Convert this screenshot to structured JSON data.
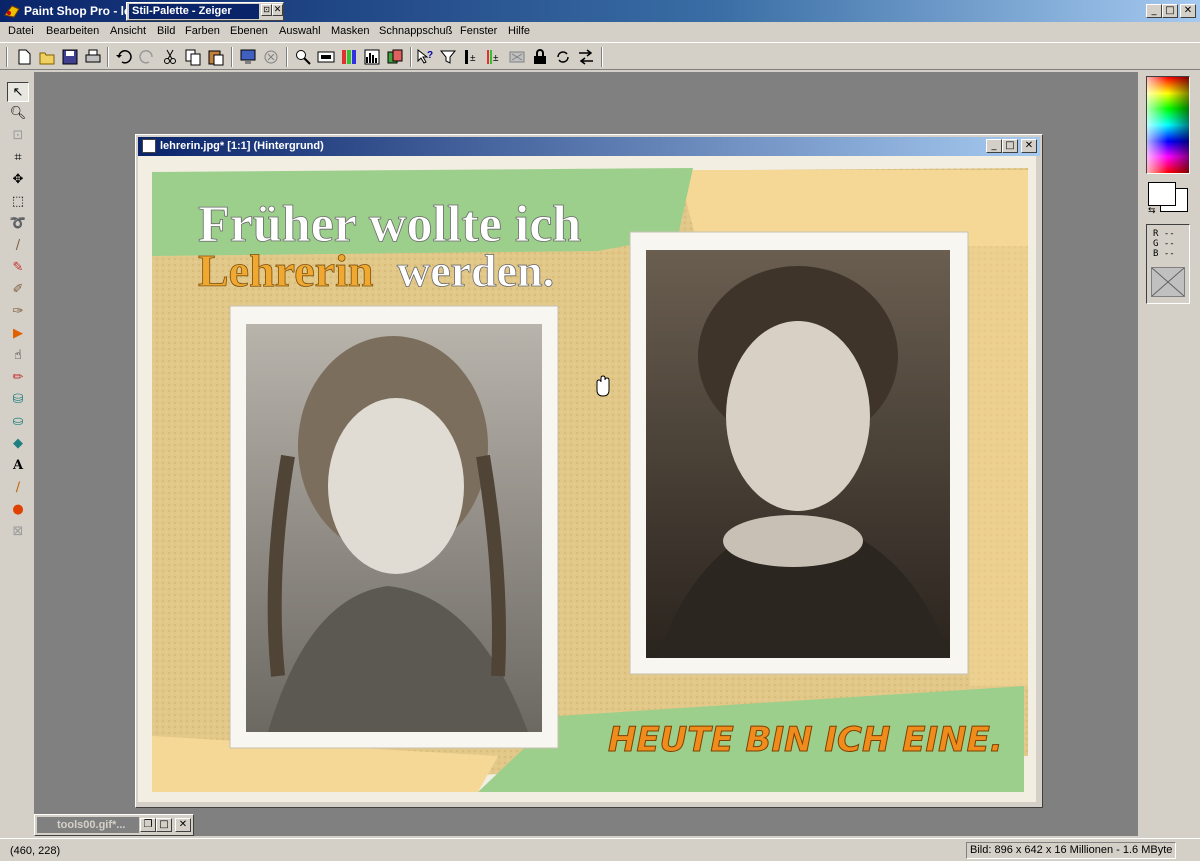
{
  "app": {
    "title": "Paint Shop Pro - le",
    "palette_title": "Stil-Palette - Zeiger"
  },
  "menu": [
    "Datei",
    "Bearbeiten",
    "Ansicht",
    "Bild",
    "Farben",
    "Ebenen",
    "Auswahl",
    "Masken",
    "Schnappschuß",
    "Fenster",
    "Hilfe"
  ],
  "document": {
    "title": "lehrerin.jpg* [1:1] (Hintergrund)",
    "headline_line1": "Früher wollte ich",
    "headline_word_highlight": "Lehrerin",
    "headline_line2_rest": "werden.",
    "footer_text": "HEUTE BIN ICH EINE."
  },
  "minimized_window": {
    "title": "tools00.gif*..."
  },
  "rgb_readout": {
    "r": "R --",
    "g": "G --",
    "b": "B --"
  },
  "status": {
    "coords": "(460, 228)",
    "image_info": "Bild:  896 x 642 x 16 Millionen - 1.6 MByte"
  },
  "colors": {
    "title_active": "#0a246a",
    "canvas_green": "#9ccf8c",
    "canvas_sand": "#e2c888",
    "canvas_yellow": "#f6d896",
    "headline_highlight": "#f0a830",
    "footer_orange": "#f08c1c"
  },
  "icons": {
    "toolbar": [
      "new-icon",
      "open-icon",
      "save-icon",
      "print-icon",
      "undo-icon",
      "redo-icon",
      "cut-icon",
      "copy-icon",
      "paste-icon",
      "monitor-icon",
      "browse-icon",
      "zoom-icon",
      "overview-icon",
      "palette-icon",
      "histogram-icon",
      "layers-icon",
      "context-help-icon",
      "filter-icon",
      "brightness-icon",
      "color-balance-icon",
      "mask-icon",
      "lock-icon",
      "refresh-icon",
      "arrows-icon"
    ],
    "tools": [
      "pointer-icon",
      "zoom-tool-icon",
      "deformation-icon",
      "crop-icon",
      "move-icon",
      "selection-icon",
      "lasso-icon",
      "dropper-icon",
      "paintbrush-icon",
      "clone-icon",
      "color-replacer-icon",
      "retouch-icon",
      "eraser-icon",
      "picture-tube-icon",
      "airbrush-icon",
      "flood-fill-icon",
      "text-icon",
      "line-icon",
      "shapes-icon",
      "object-selector-icon"
    ]
  }
}
